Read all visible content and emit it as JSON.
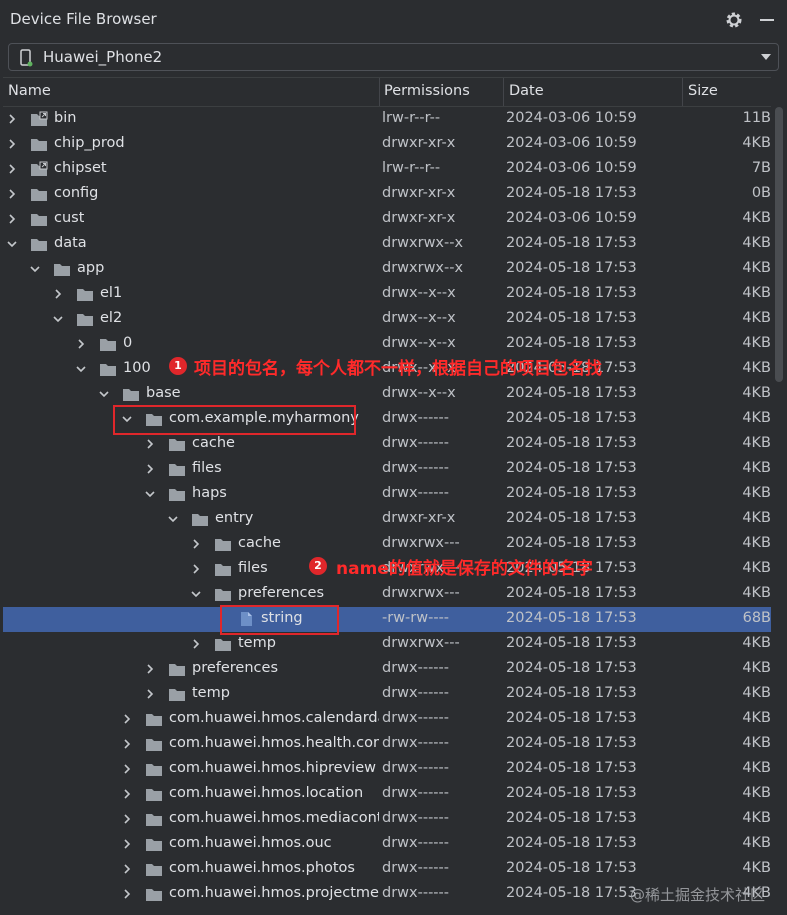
{
  "window": {
    "title": "Device File Browser"
  },
  "device": {
    "name": "Huawei_Phone2"
  },
  "columns": {
    "name": "Name",
    "permissions": "Permissions",
    "date": "Date",
    "size": "Size"
  },
  "rows": [
    {
      "name": "bin",
      "perm": "lrw-r--r--",
      "date": "2024-03-06 10:59",
      "size": "11B",
      "depth": 0,
      "expand": "closed",
      "icon": "link-folder"
    },
    {
      "name": "chip_prod",
      "perm": "drwxr-xr-x",
      "date": "2024-03-06 10:59",
      "size": "4KB",
      "depth": 0,
      "expand": "closed",
      "icon": "folder"
    },
    {
      "name": "chipset",
      "perm": "lrw-r--r--",
      "date": "2024-03-06 10:59",
      "size": "7B",
      "depth": 0,
      "expand": "closed",
      "icon": "link-folder"
    },
    {
      "name": "config",
      "perm": "drwxr-xr-x",
      "date": "2024-05-18 17:53",
      "size": "0B",
      "depth": 0,
      "expand": "closed",
      "icon": "folder"
    },
    {
      "name": "cust",
      "perm": "drwxr-xr-x",
      "date": "2024-03-06 10:59",
      "size": "4KB",
      "depth": 0,
      "expand": "closed",
      "icon": "folder"
    },
    {
      "name": "data",
      "perm": "drwxrwx--x",
      "date": "2024-05-18 17:53",
      "size": "4KB",
      "depth": 0,
      "expand": "open",
      "icon": "folder"
    },
    {
      "name": "app",
      "perm": "drwxrwx--x",
      "date": "2024-05-18 17:53",
      "size": "4KB",
      "depth": 1,
      "expand": "open",
      "icon": "folder"
    },
    {
      "name": "el1",
      "perm": "drwx--x--x",
      "date": "2024-05-18 17:53",
      "size": "4KB",
      "depth": 2,
      "expand": "closed",
      "icon": "folder"
    },
    {
      "name": "el2",
      "perm": "drwx--x--x",
      "date": "2024-05-18 17:53",
      "size": "4KB",
      "depth": 2,
      "expand": "open",
      "icon": "folder"
    },
    {
      "name": "0",
      "perm": "drwx--x--x",
      "date": "2024-05-18 17:53",
      "size": "4KB",
      "depth": 3,
      "expand": "closed",
      "icon": "folder"
    },
    {
      "name": "100",
      "perm": "drwx--x--x",
      "date": "2024-05-18 17:53",
      "size": "4KB",
      "depth": 3,
      "expand": "open",
      "icon": "folder"
    },
    {
      "name": "base",
      "perm": "drwx--x--x",
      "date": "2024-05-18 17:53",
      "size": "4KB",
      "depth": 4,
      "expand": "open",
      "icon": "folder"
    },
    {
      "name": "com.example.myharmony",
      "perm": "drwx------",
      "date": "2024-05-18 17:53",
      "size": "4KB",
      "depth": 5,
      "expand": "open",
      "icon": "folder"
    },
    {
      "name": "cache",
      "perm": "drwx------",
      "date": "2024-05-18 17:53",
      "size": "4KB",
      "depth": 6,
      "expand": "closed",
      "icon": "folder"
    },
    {
      "name": "files",
      "perm": "drwx------",
      "date": "2024-05-18 17:53",
      "size": "4KB",
      "depth": 6,
      "expand": "closed",
      "icon": "folder"
    },
    {
      "name": "haps",
      "perm": "drwx------",
      "date": "2024-05-18 17:53",
      "size": "4KB",
      "depth": 6,
      "expand": "open",
      "icon": "folder"
    },
    {
      "name": "entry",
      "perm": "drwxr-xr-x",
      "date": "2024-05-18 17:53",
      "size": "4KB",
      "depth": 7,
      "expand": "open",
      "icon": "folder"
    },
    {
      "name": "cache",
      "perm": "drwxrwx---",
      "date": "2024-05-18 17:53",
      "size": "4KB",
      "depth": 8,
      "expand": "closed",
      "icon": "folder"
    },
    {
      "name": "files",
      "perm": "drwxrwx---",
      "date": "2024-05-18 17:53",
      "size": "4KB",
      "depth": 8,
      "expand": "closed",
      "icon": "folder"
    },
    {
      "name": "preferences",
      "perm": "drwxrwx---",
      "date": "2024-05-18 17:53",
      "size": "4KB",
      "depth": 8,
      "expand": "open",
      "icon": "folder"
    },
    {
      "name": "string",
      "perm": "-rw-rw----",
      "date": "2024-05-18 17:53",
      "size": "68B",
      "depth": 9,
      "expand": "none",
      "icon": "file",
      "selected": true
    },
    {
      "name": "temp",
      "perm": "drwxrwx---",
      "date": "2024-05-18 17:53",
      "size": "4KB",
      "depth": 8,
      "expand": "closed",
      "icon": "folder"
    },
    {
      "name": "preferences",
      "perm": "drwx------",
      "date": "2024-05-18 17:53",
      "size": "4KB",
      "depth": 6,
      "expand": "closed",
      "icon": "folder"
    },
    {
      "name": "temp",
      "perm": "drwx------",
      "date": "2024-05-18 17:53",
      "size": "4KB",
      "depth": 6,
      "expand": "closed",
      "icon": "folder"
    },
    {
      "name": "com.huawei.hmos.calendardata",
      "perm": "drwx------",
      "date": "2024-05-18 17:53",
      "size": "4KB",
      "depth": 5,
      "expand": "closed",
      "icon": "folder"
    },
    {
      "name": "com.huawei.hmos.health.core",
      "perm": "drwx------",
      "date": "2024-05-18 17:53",
      "size": "4KB",
      "depth": 5,
      "expand": "closed",
      "icon": "folder"
    },
    {
      "name": "com.huawei.hmos.hipreview",
      "perm": "drwx------",
      "date": "2024-05-18 17:53",
      "size": "4KB",
      "depth": 5,
      "expand": "closed",
      "icon": "folder"
    },
    {
      "name": "com.huawei.hmos.location",
      "perm": "drwx------",
      "date": "2024-05-18 17:53",
      "size": "4KB",
      "depth": 5,
      "expand": "closed",
      "icon": "folder"
    },
    {
      "name": "com.huawei.hmos.mediacontro",
      "perm": "drwx------",
      "date": "2024-05-18 17:53",
      "size": "4KB",
      "depth": 5,
      "expand": "closed",
      "icon": "folder"
    },
    {
      "name": "com.huawei.hmos.ouc",
      "perm": "drwx------",
      "date": "2024-05-18 17:53",
      "size": "4KB",
      "depth": 5,
      "expand": "closed",
      "icon": "folder"
    },
    {
      "name": "com.huawei.hmos.photos",
      "perm": "drwx------",
      "date": "2024-05-18 17:53",
      "size": "4KB",
      "depth": 5,
      "expand": "closed",
      "icon": "folder"
    },
    {
      "name": "com.huawei.hmos.projectmenu",
      "perm": "drwx------",
      "date": "2024-05-18 17:53",
      "size": "4KB",
      "depth": 5,
      "expand": "closed",
      "icon": "folder"
    }
  ],
  "annotations": {
    "one": {
      "num": "1",
      "text": "项目的包名，每个人都不一样，根据自己的项目包名找"
    },
    "two": {
      "num": "2",
      "text": "name的值就是保存的文件的名字"
    }
  },
  "watermark": "@稀土掘金技术社区",
  "colors": {
    "background": "#2b2d30",
    "selection": "#3f5f9e",
    "annotation": "#e0272b",
    "folder": "#9aa0a6"
  }
}
